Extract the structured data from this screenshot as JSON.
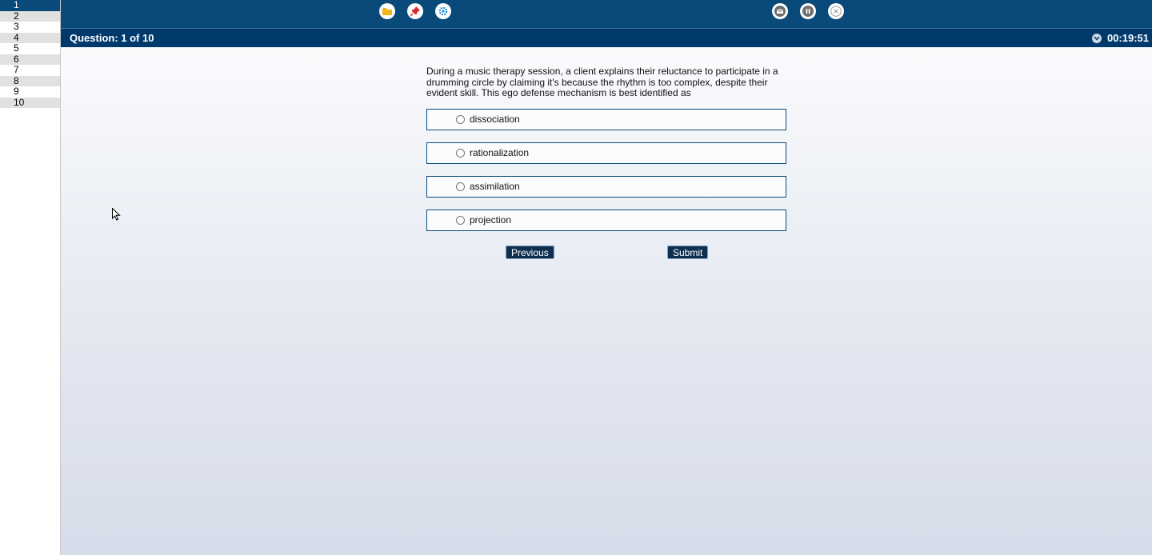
{
  "nav": {
    "questions": [
      "1",
      "2",
      "3",
      "4",
      "5",
      "6",
      "7",
      "8",
      "9",
      "10"
    ],
    "current": "1"
  },
  "toolbar": {
    "left_icons": [
      "folder-icon",
      "pin-icon",
      "settings-icon"
    ],
    "right_icons": [
      "mail-icon",
      "pause-icon",
      "close-icon"
    ]
  },
  "header": {
    "question_counter": "Question: 1 of 10",
    "timer": "00:19:51"
  },
  "question": {
    "stem": "During a music therapy session, a client explains their reluctance to participate in a drumming circle by claiming it's because the rhythm is too complex, despite their evident skill. This ego defense mechanism is best identified as",
    "options": [
      "dissociation",
      "rationalization",
      "assimilation",
      "projection"
    ]
  },
  "buttons": {
    "previous": "Previous",
    "submit": "Submit"
  },
  "colors": {
    "primary": "#0a4a7a",
    "header": "#003a6c",
    "button": "#0c2f52"
  }
}
